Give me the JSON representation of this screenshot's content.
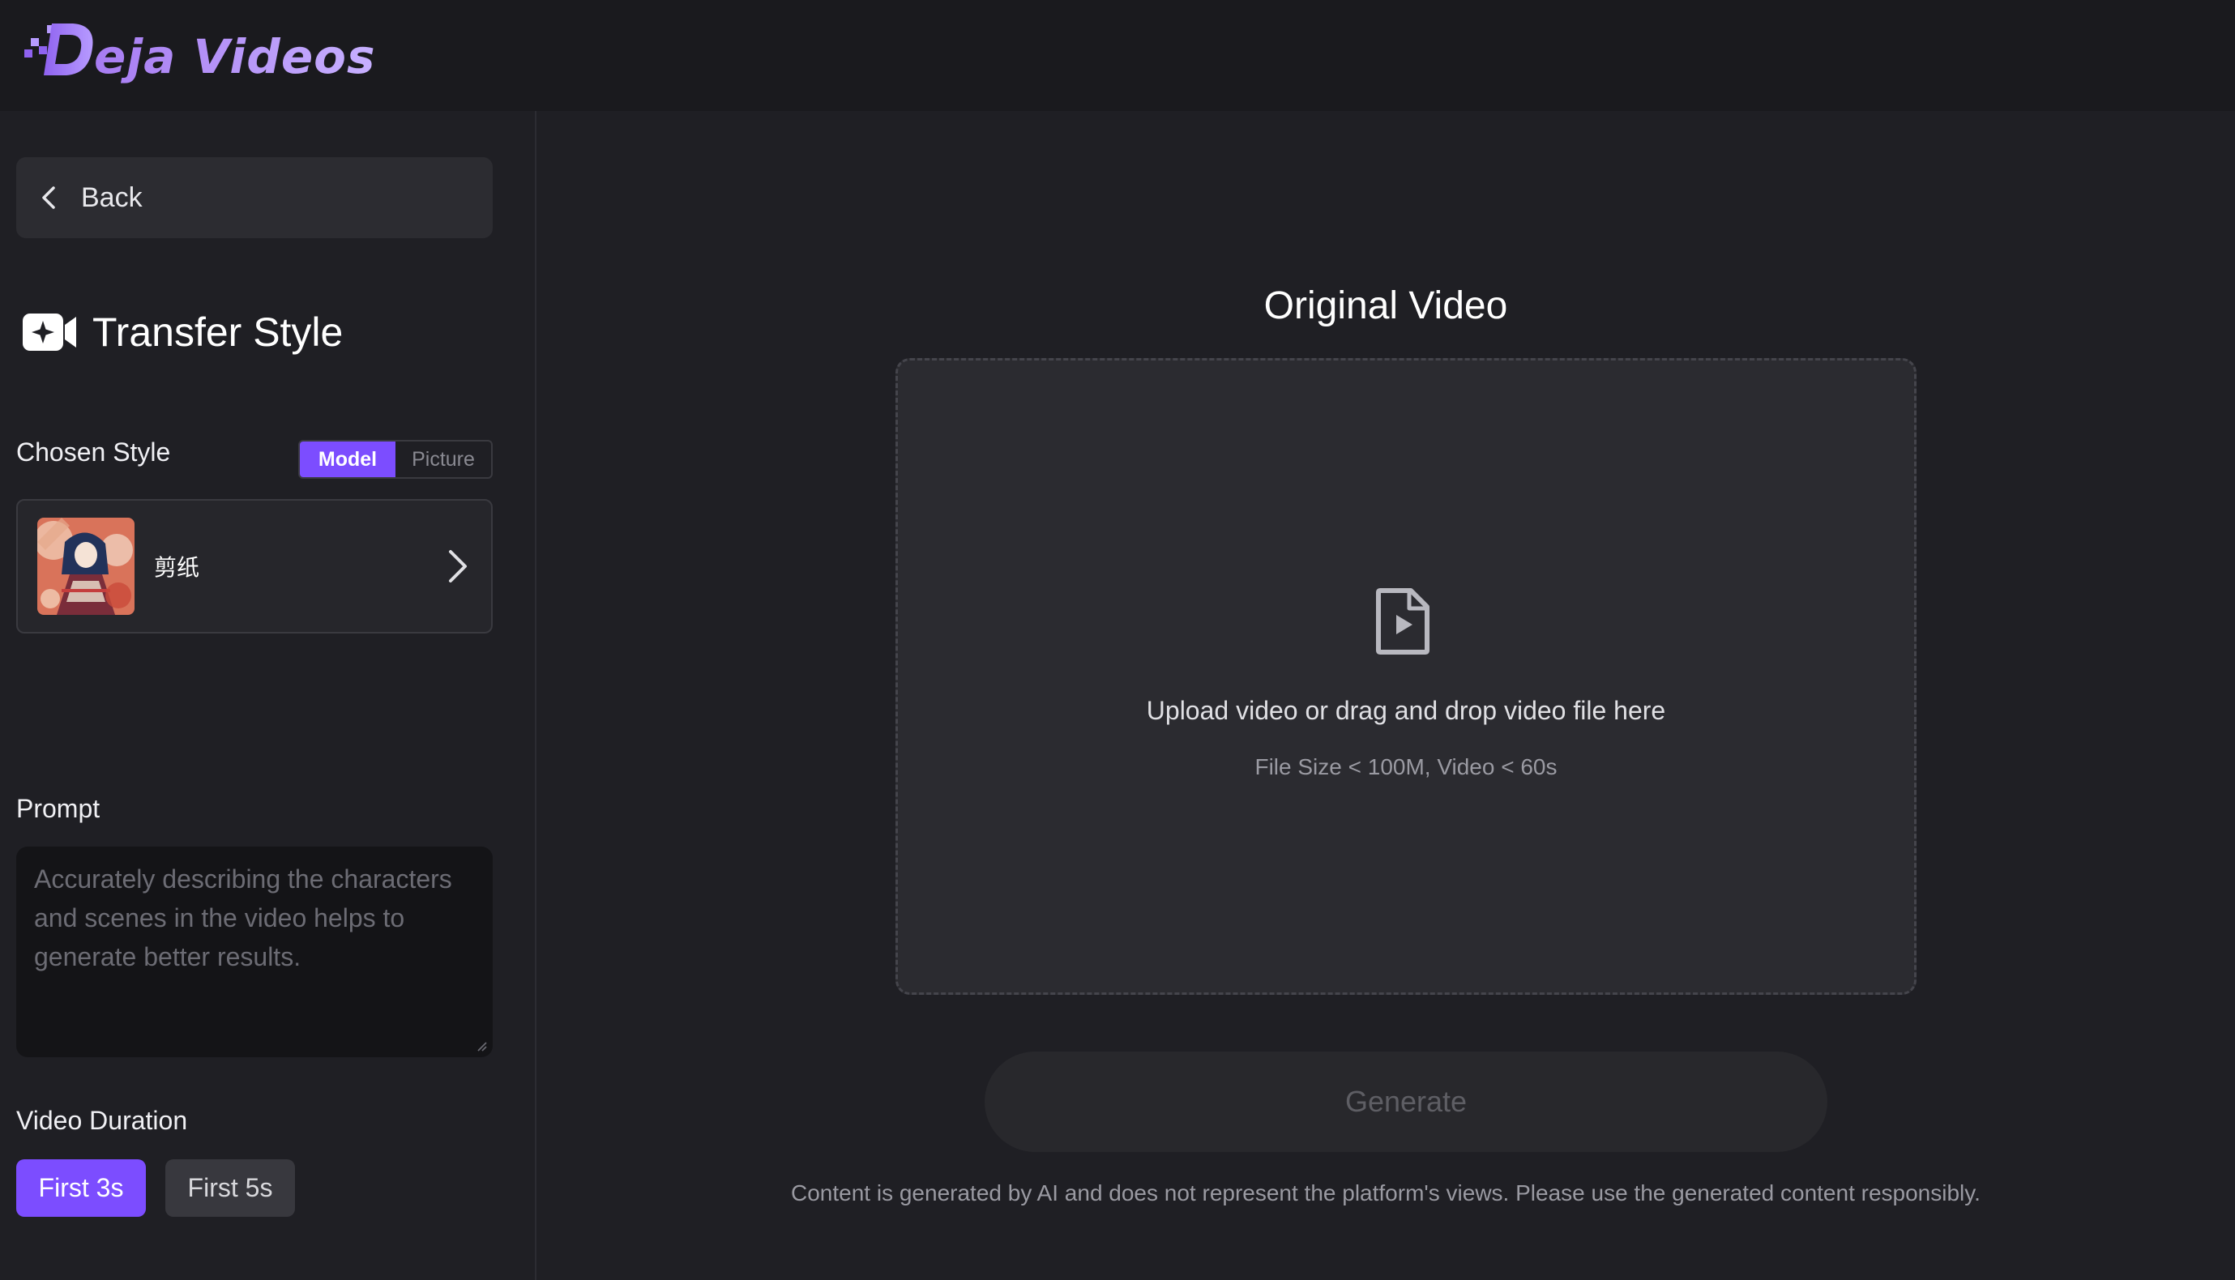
{
  "app": {
    "logo_text": "eja Videos",
    "logo_letter": "D"
  },
  "sidebar": {
    "back_label": "Back",
    "section_title": "Transfer Style",
    "chosen_style_label": "Chosen Style",
    "style_toggle": {
      "options": [
        "Model",
        "Picture"
      ],
      "selected": "Model"
    },
    "chosen_style": {
      "name": "剪纸"
    },
    "prompt_label": "Prompt",
    "prompt_placeholder": "Accurately describing the characters and scenes in the video helps to generate better results.",
    "prompt_value": "",
    "duration_label": "Video Duration",
    "duration_options": [
      "First 3s",
      "First 5s"
    ],
    "duration_selected": "First 3s"
  },
  "main": {
    "title": "Original Video",
    "upload_text": "Upload video or drag and drop video file here",
    "upload_hint": "File Size < 100M, Video < 60s",
    "generate_label": "Generate",
    "disclaimer": "Content is generated by AI and does not represent the platform's views. Please use the generated content responsibly."
  },
  "colors": {
    "accent": "#7c4dff",
    "background": "#1f1f24",
    "topbar": "#1a1a1e",
    "panel": "#2b2b30"
  },
  "icons": {
    "logo": "deja-logo-icon",
    "back": "chevron-left-icon",
    "section": "video-camera-sparkle-icon",
    "card": "chevron-right-icon",
    "upload": "video-file-icon"
  }
}
